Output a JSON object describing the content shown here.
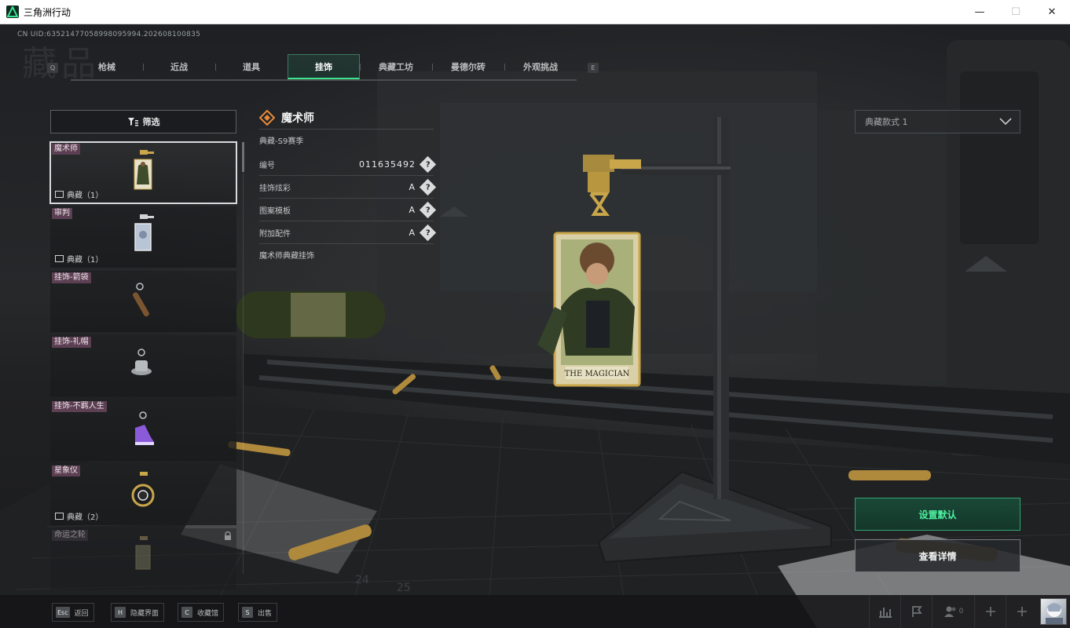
{
  "window": {
    "title": "三角洲行动",
    "controls": {
      "minimize": "—",
      "maximize": "☐",
      "close": "✕"
    }
  },
  "header": {
    "uid": "CN UID:63521477058998095994.202608100835",
    "ghost_title": "藏品"
  },
  "tabs": {
    "prev_key": "Q",
    "next_key": "E",
    "items": [
      {
        "label": "枪械",
        "active": false
      },
      {
        "label": "近战",
        "active": false
      },
      {
        "label": "道具",
        "active": false
      },
      {
        "label": "挂饰",
        "active": true
      },
      {
        "label": "典藏工坊",
        "active": false
      },
      {
        "label": "曼德尔砖",
        "active": false
      },
      {
        "label": "外观挑战",
        "active": false
      }
    ]
  },
  "filter": {
    "label": "筛选"
  },
  "items": [
    {
      "tag": "魔术师",
      "count": "典藏（1）",
      "selected": true,
      "locked": false
    },
    {
      "tag": "审判",
      "count": "典藏（1）",
      "selected": false,
      "locked": false
    },
    {
      "tag": "挂饰-箭袋",
      "count": "",
      "selected": false,
      "locked": false
    },
    {
      "tag": "挂饰-礼帽",
      "count": "",
      "selected": false,
      "locked": false
    },
    {
      "tag": "挂饰-不羁人生",
      "count": "",
      "selected": false,
      "locked": false
    },
    {
      "tag": "星象仪",
      "count": "典藏（2）",
      "selected": false,
      "locked": false
    },
    {
      "tag": "命运之轮",
      "count": "",
      "selected": false,
      "locked": true
    }
  ],
  "detail": {
    "name": "魔术师",
    "season": "典藏-S9赛季",
    "properties": [
      {
        "label": "编号",
        "value": "011635492"
      },
      {
        "label": "挂饰炫彩",
        "value": "A"
      },
      {
        "label": "图案模板",
        "value": "A"
      },
      {
        "label": "附加配件",
        "value": "A"
      }
    ],
    "description": "魔术师典藏挂饰",
    "help_icon": "?"
  },
  "showcase": {
    "card_caption": "THE MAGICIAN"
  },
  "style_select": {
    "value": "典藏款式 1"
  },
  "actions": {
    "set_default": "设置默认",
    "view_details": "查看详情"
  },
  "bottom_hints": [
    {
      "key": "Esc",
      "label": "返回"
    },
    {
      "key": "H",
      "label": "隐藏界面"
    },
    {
      "key": "C",
      "label": "收藏馆"
    },
    {
      "key": "S",
      "label": "出售"
    }
  ],
  "bottom_right": {
    "friends_count": "0"
  },
  "colors": {
    "accent_green": "#3ee38d",
    "tag_purple": "#5c3f52",
    "card_gold": "#c9a64a"
  }
}
